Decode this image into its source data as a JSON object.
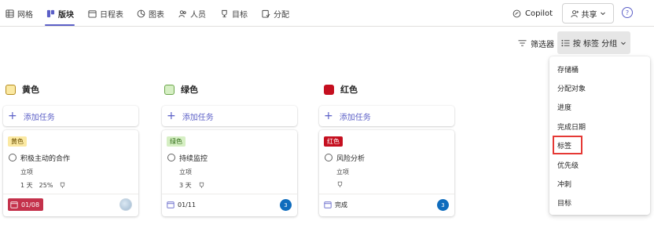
{
  "tabs": [
    {
      "label": "网格",
      "icon": "grid-icon"
    },
    {
      "label": "版块",
      "icon": "board-icon",
      "active": true
    },
    {
      "label": "日程表",
      "icon": "calendar-icon"
    },
    {
      "label": "图表",
      "icon": "chart-icon"
    },
    {
      "label": "人员",
      "icon": "people-icon"
    },
    {
      "label": "目标",
      "icon": "trophy-icon"
    },
    {
      "label": "分配",
      "icon": "assign-icon"
    }
  ],
  "header": {
    "copilot_label": "Copilot",
    "share_label": "共享",
    "help_glyph": "?"
  },
  "toolbar": {
    "filter_label": "筛选器",
    "group_label": "按 标签 分组"
  },
  "add_task_label": "添加任务",
  "columns": [
    {
      "name": "黄色",
      "color": "#fbe9a3",
      "task": {
        "badge": "黄色",
        "badge_color": "#fbe9a3",
        "badge_text_color": "#6b4e00",
        "title": "积极主动的合作",
        "bucket": "立项",
        "duration": "1 天",
        "progress": "25%",
        "due": "01/08",
        "overdue": true
      }
    },
    {
      "name": "绿色",
      "color": "#d6efc4",
      "task": {
        "badge": "绿色",
        "badge_color": "#d6efc4",
        "badge_text_color": "#2f6c16",
        "title": "持续监控",
        "bucket": "立项",
        "duration": "3 天",
        "due": "01/11",
        "comment_count": "3"
      }
    },
    {
      "name": "红色",
      "color": "#c50f1f",
      "task": {
        "badge": "红色",
        "badge_color": "#c50f1f",
        "badge_text_color": "#ffffff",
        "title": "风险分析",
        "bucket": "立项",
        "due": "完成",
        "comment_count": "3"
      }
    }
  ],
  "group_menu": {
    "items": [
      "存储桶",
      "分配对象",
      "进度",
      "完成日期",
      "标签",
      "优先级",
      "冲刺",
      "目标"
    ],
    "selected": "标签"
  }
}
